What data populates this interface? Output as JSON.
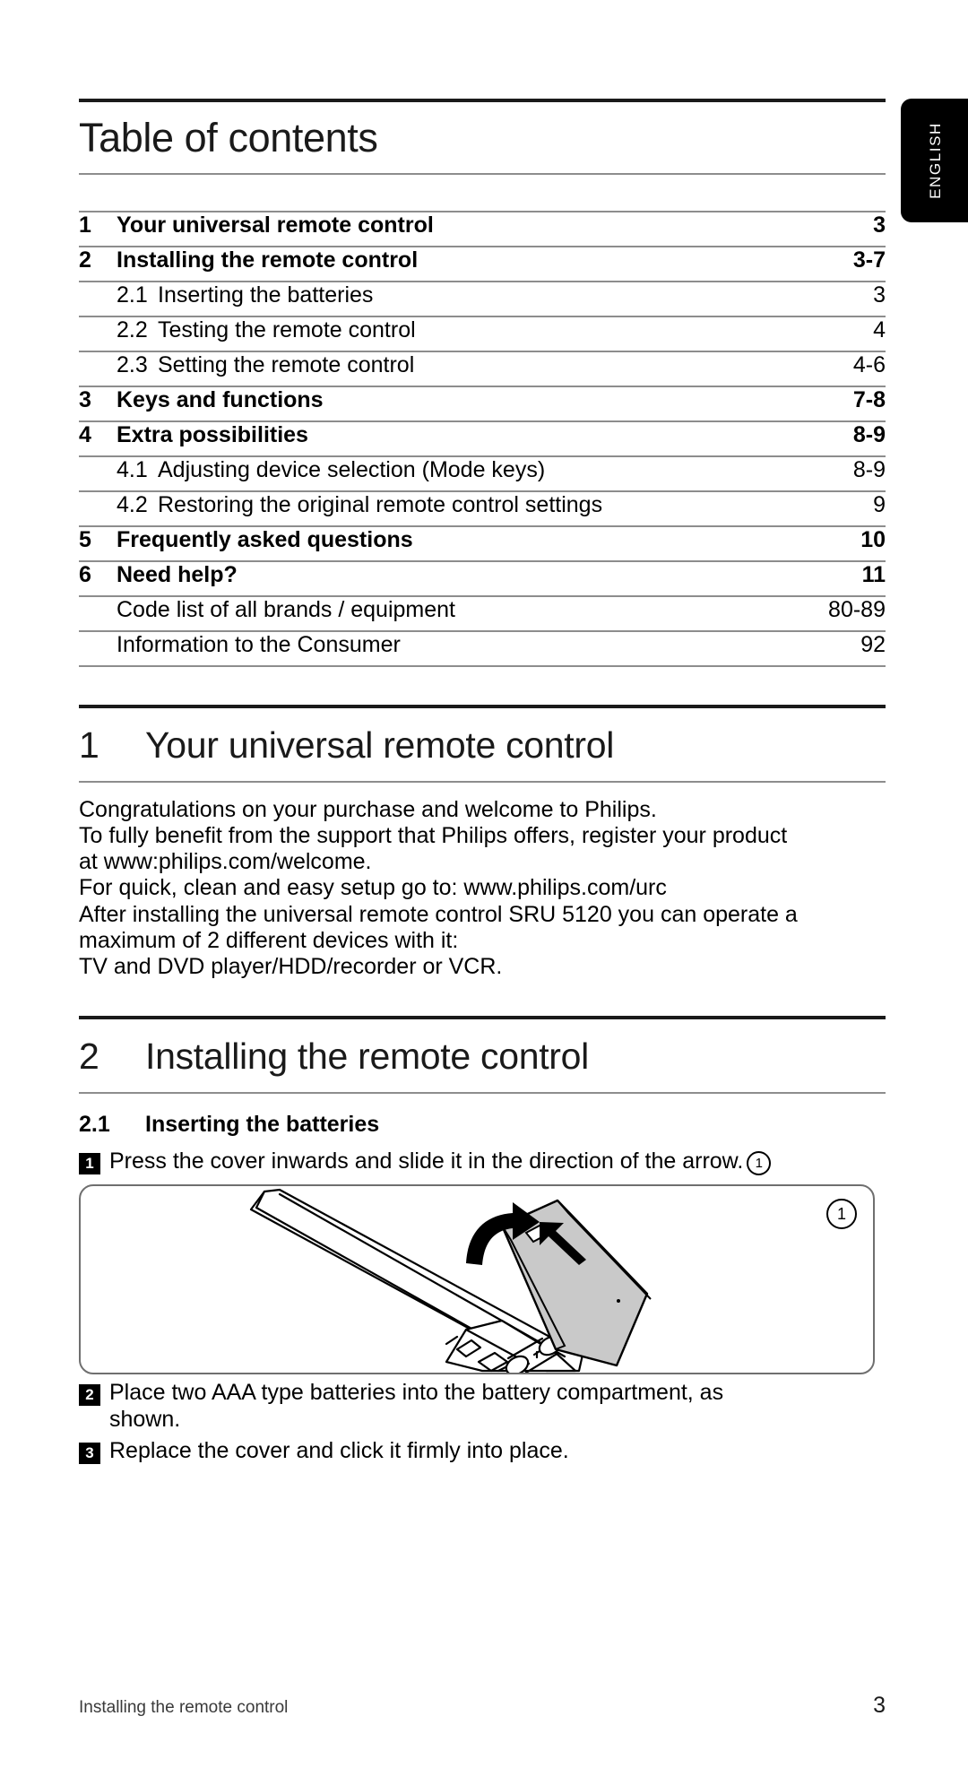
{
  "language_tab": {
    "label": "ENGLISH"
  },
  "toc": {
    "title": "Table of contents",
    "rows": [
      {
        "num": "1",
        "sub": "",
        "label": "Your universal remote control",
        "pages": "3",
        "level": 1
      },
      {
        "num": "2",
        "sub": "",
        "label": "Installing the remote control",
        "pages": "3-7",
        "level": 1
      },
      {
        "num": "",
        "sub": "2.1",
        "label": "Inserting the batteries",
        "pages": "3",
        "level": 2
      },
      {
        "num": "",
        "sub": "2.2",
        "label": "Testing the remote control",
        "pages": "4",
        "level": 2
      },
      {
        "num": "",
        "sub": "2.3",
        "label": "Setting the remote control",
        "pages": "4-6",
        "level": 2
      },
      {
        "num": "3",
        "sub": "",
        "label": "Keys and functions",
        "pages": "7-8",
        "level": 1
      },
      {
        "num": "4",
        "sub": "",
        "label": "Extra possibilities",
        "pages": "8-9",
        "level": 1
      },
      {
        "num": "",
        "sub": "4.1",
        "label": "Adjusting device selection (Mode keys)",
        "pages": "8-9",
        "level": 2
      },
      {
        "num": "",
        "sub": "4.2",
        "label": "Restoring the original remote control settings",
        "pages": "9",
        "level": 2
      },
      {
        "num": "5",
        "sub": "",
        "label": "Frequently asked questions",
        "pages": "10",
        "level": 1
      },
      {
        "num": "6",
        "sub": "",
        "label": "Need help?",
        "pages": "11",
        "level": 1
      },
      {
        "num": "",
        "sub": "",
        "label": "Code list of all brands / equipment",
        "pages": "80-89",
        "level": 0
      },
      {
        "num": "",
        "sub": "",
        "label": "Information to the Consumer",
        "pages": "92",
        "level": 0
      }
    ]
  },
  "section1": {
    "number": "1",
    "title": "Your universal remote control",
    "lines": [
      "Congratulations on your purchase and welcome to Philips.",
      "To fully benefit from the support that Philips offers, register your product",
      "at www:philips.com/welcome.",
      "For quick, clean and easy setup go to: www.philips.com/urc",
      "After installing the universal remote control SRU 5120 you can operate a",
      "maximum of 2 different devices with it:",
      "TV and DVD player/HDD/recorder or VCR."
    ]
  },
  "section2": {
    "number": "2",
    "title": "Installing the remote control",
    "subsection": {
      "number": "2.1",
      "title": "Inserting the batteries"
    },
    "steps": [
      {
        "badge": "1",
        "lines": [
          "Press the cover inwards and slide it in the direction of the arrow."
        ],
        "trailing_circle": "1"
      },
      {
        "badge": "2",
        "lines": [
          "Place two AAA type batteries into the battery compartment, as",
          "shown."
        ],
        "trailing_circle": ""
      },
      {
        "badge": "3",
        "lines": [
          "Replace the cover and click it firmly into place."
        ],
        "trailing_circle": ""
      }
    ],
    "illustration": {
      "marker": "1",
      "caption": "remote-control-battery-cover-diagram"
    }
  },
  "footer": {
    "left": "Installing the remote control",
    "page_number": "3"
  }
}
